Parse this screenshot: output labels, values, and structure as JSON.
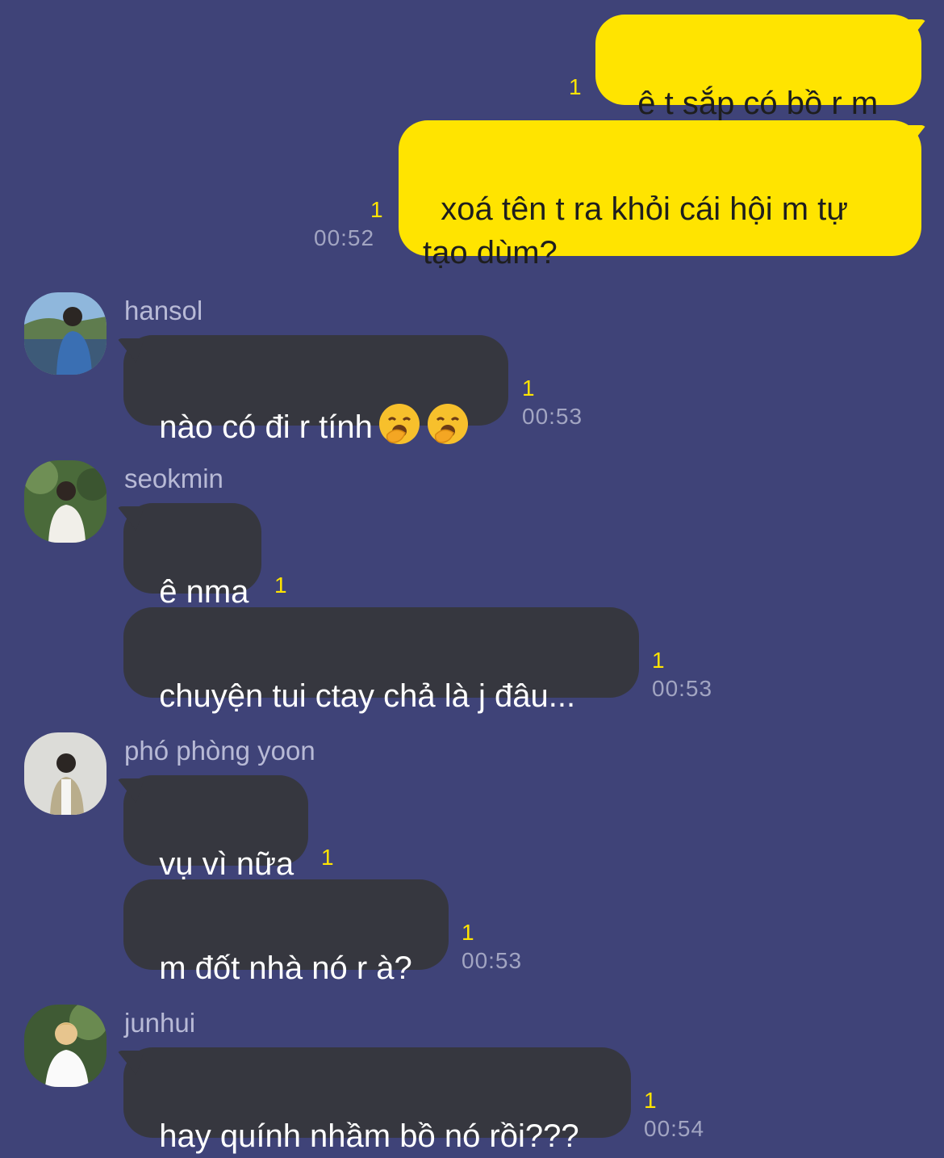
{
  "chat": {
    "outgoing": [
      {
        "text": "ê t sắp có bồ r m",
        "unread": "1"
      },
      {
        "text": "xoá tên t ra khỏi cái hội m tự\ntạo dùm?",
        "unread": "1",
        "time": "00:52"
      }
    ],
    "groups": [
      {
        "sender": "hansol",
        "avatar_icon": "profile-photo-hansol",
        "messages": [
          {
            "text": "nào có đi r tính",
            "emoji": [
              "yawning-face-emoji",
              "yawning-face-emoji"
            ],
            "unread": "1",
            "time": "00:53"
          }
        ]
      },
      {
        "sender": "seokmin",
        "avatar_icon": "profile-photo-seokmin",
        "messages": [
          {
            "text": "ê nma",
            "unread": "1"
          },
          {
            "text": "chuyện tui ctay chả là j đâu...",
            "unread": "1",
            "time": "00:53"
          }
        ]
      },
      {
        "sender": "phó phòng yoon",
        "avatar_icon": "profile-photo-yoon",
        "messages": [
          {
            "text": "vụ vì nữa",
            "unread": "1"
          },
          {
            "text": "m đốt nhà nó r à?",
            "unread": "1",
            "time": "00:53"
          }
        ]
      },
      {
        "sender": "junhui",
        "avatar_icon": "profile-photo-junhui",
        "messages": [
          {
            "text": "hay quính nhầm bồ nó rồi???",
            "unread": "1",
            "time": "00:54"
          }
        ]
      }
    ],
    "colors": {
      "background": "#3f4378",
      "outgoing_bubble": "#ffe400",
      "incoming_bubble": "#36373f",
      "unread_count": "#ffe400"
    }
  }
}
